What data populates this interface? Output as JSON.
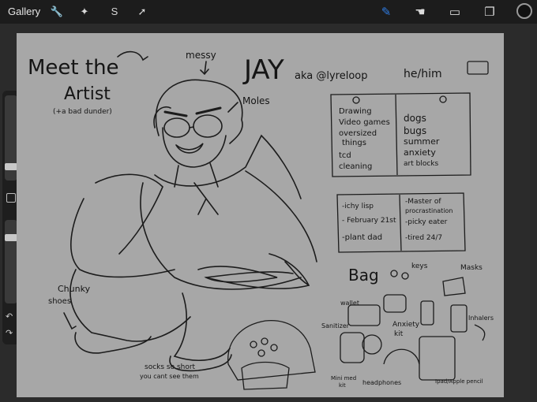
{
  "app": {
    "gallery_label": "Gallery"
  },
  "toolbar": {
    "left_icons": [
      "wrench-icon",
      "magic-wand-icon",
      "selection-icon",
      "transform-arrow-icon"
    ],
    "right_icons": [
      "brush-icon",
      "smudge-icon",
      "eraser-icon",
      "layers-icon"
    ],
    "active_color": "#111111",
    "accent_color": "#2f7be0"
  },
  "artwork": {
    "heading_line1": "Meet the",
    "heading_line2": "Artist",
    "heading_sub": "(+a bad dunder)",
    "messy": "messy",
    "name": "JAY",
    "aka": "aka @lyreloop",
    "pronouns": "he/him",
    "moles": "Moles",
    "likes": [
      "Drawing",
      "Video games",
      "oversized",
      "things",
      "tcd",
      "cleaning"
    ],
    "dislikes": [
      "dogs",
      "bugs",
      "summer",
      "anxiety",
      "art blocks"
    ],
    "facts_left": [
      "-ichy lisp",
      "- February 21st",
      "-plant dad"
    ],
    "facts_right": [
      "-Master of",
      "procrastination",
      "-picky eater",
      "-tired 24/7"
    ],
    "bag_title": "Bag",
    "bag_items": [
      "keys",
      "Masks",
      "wallet",
      "Inhalers",
      "Sanitizer",
      "Anxiety",
      "kit",
      "Mini med",
      "kit",
      "headphones",
      "Ipad/Apple pencil"
    ],
    "chunky": "Chunky",
    "shoes": "shoes",
    "socks_note1": "socks so short",
    "socks_note2": "you cant see them"
  }
}
